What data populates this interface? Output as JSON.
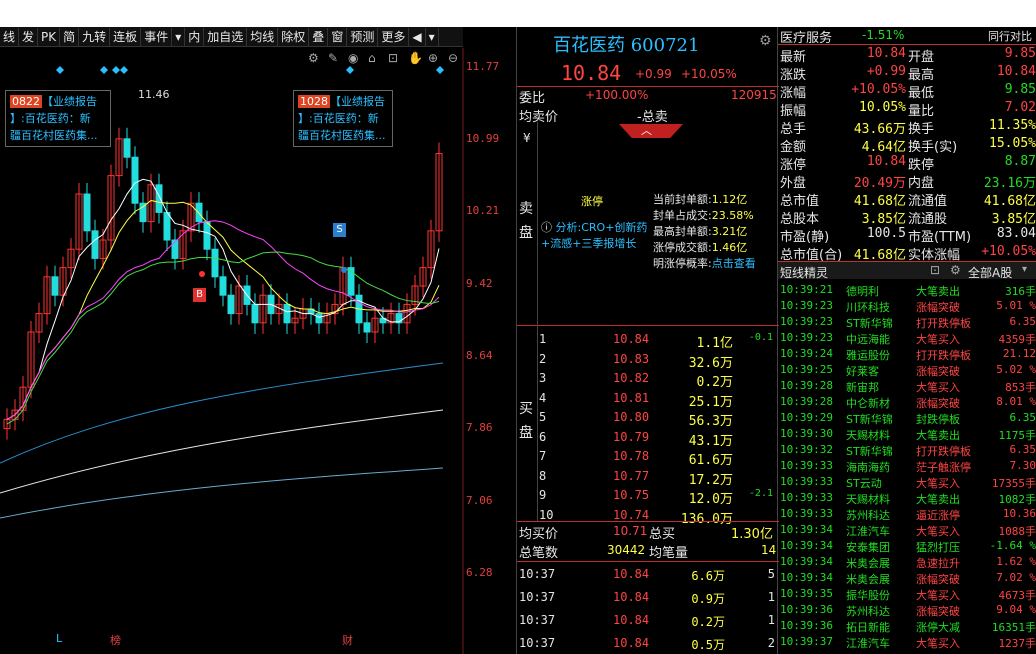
{
  "toolbar": [
    "线",
    "发",
    "PK",
    "简",
    "九转",
    "连板",
    "事件",
    "▾",
    "内",
    "加自选",
    "均线",
    "除权",
    "叠",
    "窗",
    "预测",
    "更多",
    "◀",
    "▾"
  ],
  "chart_icons": [
    "gear-icon",
    "brush-icon",
    "eye-icon",
    "basket-icon",
    "lock-icon",
    "hand-icon",
    "zoom-in-icon",
    "zoom-out-icon"
  ],
  "price_axis": [
    "11.77",
    "10.99",
    "10.21",
    "9.42",
    "8.64",
    "7.86",
    "7.06",
    "6.28"
  ],
  "high_marker": "11.46",
  "info1": {
    "date": "0822",
    "title": "【业绩报告",
    "l2": "】:百花医药：新",
    "l3": "疆百花村医药集..."
  },
  "info2": {
    "date": "1028",
    "title": "【业绩报告",
    "l2": "】:百花医药：新",
    "l3": "疆百花村医药集..."
  },
  "markers": {
    "s": "S",
    "b": "B",
    "l": "L",
    "bang": "榜",
    "cai": "财"
  },
  "quote": {
    "name": "百花医药",
    "code": "600721",
    "price": "10.84",
    "change": "+0.99",
    "pct": "+10.05%"
  },
  "weibi": {
    "label": "委比",
    "pct": "+100.00%",
    "diff": "120915"
  },
  "jmj": {
    "label": "均卖价",
    "sep": "-",
    "total": "总卖"
  },
  "sell_side": {
    "label_top": "卖",
    "label_bot": "盘",
    "yen": "¥"
  },
  "limit": {
    "title": "涨停",
    "rows": [
      [
        "当前封单额:",
        "1.12亿"
      ],
      [
        "封单占成交:",
        "23.58%"
      ],
      [
        "最高封单额:",
        "3.21亿"
      ],
      [
        "涨停成交额:",
        "1.46亿"
      ],
      [
        "明涨停概率:",
        "点击查看"
      ]
    ],
    "analysis": "分析:CRO+创新药",
    "analysis2": "+流感+三季报增长"
  },
  "buy_label": {
    "top": "买",
    "bot": "盘"
  },
  "bids": [
    [
      "1",
      "10.84",
      "1.1亿",
      "-0.1"
    ],
    [
      "2",
      "10.83",
      "32.6万",
      ""
    ],
    [
      "3",
      "10.82",
      "0.2万",
      ""
    ],
    [
      "4",
      "10.81",
      "25.1万",
      ""
    ],
    [
      "5",
      "10.80",
      "56.3万",
      ""
    ],
    [
      "6",
      "10.79",
      "43.1万",
      ""
    ],
    [
      "7",
      "10.78",
      "61.6万",
      ""
    ],
    [
      "8",
      "10.77",
      "17.2万",
      ""
    ],
    [
      "9",
      "10.75",
      "12.0万",
      "-2.1"
    ],
    [
      "10",
      "10.74",
      "136.0万",
      ""
    ]
  ],
  "summary": {
    "jmjlabel": "均买价",
    "jmj": "10.71",
    "zmlabel": "总买",
    "zm": "1.30亿",
    "zbslabel": "总笔数",
    "zbs": "30442",
    "jbllabel": "均笔量",
    "jbl": "14"
  },
  "ticks": [
    [
      "10:37",
      "10.84",
      "6.6万",
      "5"
    ],
    [
      "10:37",
      "10.84",
      "0.9万",
      "1"
    ],
    [
      "10:37",
      "10.84",
      "0.2万",
      "1"
    ],
    [
      "10:37",
      "10.84",
      "0.5万",
      "2"
    ]
  ],
  "sector": {
    "name": "医疗服务",
    "pct": "-1.51%",
    "link": "同行对比"
  },
  "stats": [
    [
      "最新",
      "10.84",
      "开盘",
      "9.85"
    ],
    [
      "涨跌",
      "+0.99",
      "最高",
      "10.84"
    ],
    [
      "涨幅",
      "+10.05%",
      "最低",
      "9.85"
    ],
    [
      "振幅",
      "10.05%",
      "量比",
      "7.02"
    ],
    [
      "总手",
      "43.66万",
      "换手",
      "11.35%"
    ],
    [
      "金额",
      "4.64亿",
      "换手(实)",
      "15.05%"
    ],
    [
      "涨停",
      "10.84",
      "跌停",
      "8.87"
    ],
    [
      "外盘",
      "20.49万",
      "内盘",
      "23.16万"
    ],
    [
      "总市值",
      "41.68亿",
      "流通值",
      "41.68亿"
    ],
    [
      "总股本",
      "3.85亿",
      "流通股",
      "3.85亿"
    ],
    [
      "市盈(静)",
      "100.5",
      "市盈(TTM)",
      "83.04"
    ],
    [
      "总市值(合)",
      "41.68亿",
      "实体涨幅",
      "+10.05%"
    ]
  ],
  "stat_colors": [
    [
      "r",
      "r"
    ],
    [
      "r",
      "r"
    ],
    [
      "r",
      "g"
    ],
    [
      "y",
      "r"
    ],
    [
      "y",
      "y"
    ],
    [
      "y",
      "y"
    ],
    [
      "r",
      "g"
    ],
    [
      "r",
      "g"
    ],
    [
      "y",
      "y"
    ],
    [
      "y",
      "y"
    ],
    [
      "w",
      "w"
    ],
    [
      "y",
      "r"
    ]
  ],
  "sprite": {
    "title": "短线精灵",
    "filter": "全部A股"
  },
  "sprite_rows": [
    [
      "10:39:21",
      "德明利",
      "大笔卖出",
      "316手",
      "g"
    ],
    [
      "10:39:23",
      "川环科技",
      "涨幅突破",
      "5.01 %",
      "r"
    ],
    [
      "10:39:23",
      "ST新华锦",
      "打开跌停板",
      "6.35",
      "r"
    ],
    [
      "10:39:23",
      "中远海能",
      "大笔买入",
      "4359手",
      "r"
    ],
    [
      "10:39:24",
      "雅运股份",
      "打开跌停板",
      "21.12",
      "r"
    ],
    [
      "10:39:25",
      "好莱客",
      "涨幅突破",
      "5.02 %",
      "r"
    ],
    [
      "10:39:28",
      "新宙邦",
      "大笔买入",
      "853手",
      "r"
    ],
    [
      "10:39:28",
      "中仑新材",
      "涨幅突破",
      "8.01 %",
      "r"
    ],
    [
      "10:39:29",
      "ST新华锦",
      "封跌停板",
      "6.35",
      "g"
    ],
    [
      "10:39:30",
      "天赐材料",
      "大笔卖出",
      "1175手",
      "g"
    ],
    [
      "10:39:32",
      "ST新华锦",
      "打开跌停板",
      "6.35",
      "r"
    ],
    [
      "10:39:33",
      "海南海药",
      "茫子触涨停",
      "7.30",
      "r"
    ],
    [
      "10:39:33",
      "ST云动",
      "大笔买入",
      "17355手",
      "r"
    ],
    [
      "10:39:33",
      "天赐材料",
      "大笔卖出",
      "1082手",
      "g"
    ],
    [
      "10:39:33",
      "苏州科达",
      "逼近涨停",
      "10.36",
      "r"
    ],
    [
      "10:39:34",
      "江淮汽车",
      "大笔买入",
      "1088手",
      "r"
    ],
    [
      "10:39:34",
      "安泰集团",
      "猛烈打压",
      "-1.64 %",
      "g"
    ],
    [
      "10:39:34",
      "米奥会展",
      "急速拉升",
      "1.62 %",
      "r"
    ],
    [
      "10:39:34",
      "米奥会展",
      "涨幅突破",
      "7.02 %",
      "r"
    ],
    [
      "10:39:35",
      "振华股份",
      "大笔买入",
      "4673手",
      "r"
    ],
    [
      "10:39:36",
      "苏州科达",
      "涨幅突破",
      "9.04 %",
      "r"
    ],
    [
      "10:39:36",
      "拓日新能",
      "涨停大减",
      "16351手",
      "g"
    ],
    [
      "10:39:37",
      "江淮汽车",
      "大笔买入",
      "1237手",
      "r"
    ]
  ],
  "colors": {
    "up": "#ff4444",
    "down": "#22dd22",
    "accent": "#2ac0ff",
    "bg": "#000000"
  }
}
